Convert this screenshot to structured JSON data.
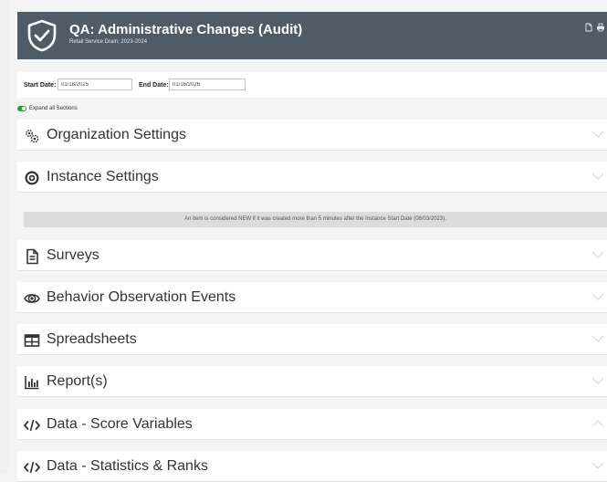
{
  "header": {
    "title": "QA: Administrative Changes (Audit)",
    "subtitle": "Retail Service Drain: 2023-2024",
    "icons": [
      "shield-check-icon",
      "document-icon",
      "print-icon"
    ],
    "background": "#4f5b66"
  },
  "filters": {
    "start_label": "Start Date:",
    "start_value": "01/18/2025",
    "end_label": "End Date:",
    "end_value": "01/16/2026"
  },
  "expand_toggle": {
    "label": "Expand all Sections",
    "on": true,
    "color": "#23a636"
  },
  "notice": "An item is considered NEW if it was created more than 5 minutes after the Instance Start Date (08/03/2023).",
  "sections": [
    {
      "label": "Organization Settings",
      "icon": "gears-icon",
      "expanded": false
    },
    {
      "label": "Instance Settings",
      "icon": "target-icon",
      "expanded": false
    },
    {
      "label": "Surveys",
      "icon": "document-icon",
      "expanded": false
    },
    {
      "label": "Behavior Observation Events",
      "icon": "eye-icon",
      "expanded": false
    },
    {
      "label": "Spreadsheets",
      "icon": "table-icon",
      "expanded": false
    },
    {
      "label": "Report(s)",
      "icon": "bar-chart-icon",
      "expanded": false
    },
    {
      "label": "Data - Score Variables",
      "icon": "code-icon",
      "expanded": true
    },
    {
      "label": "Data - Statistics & Ranks",
      "icon": "code-icon",
      "expanded": false
    }
  ]
}
